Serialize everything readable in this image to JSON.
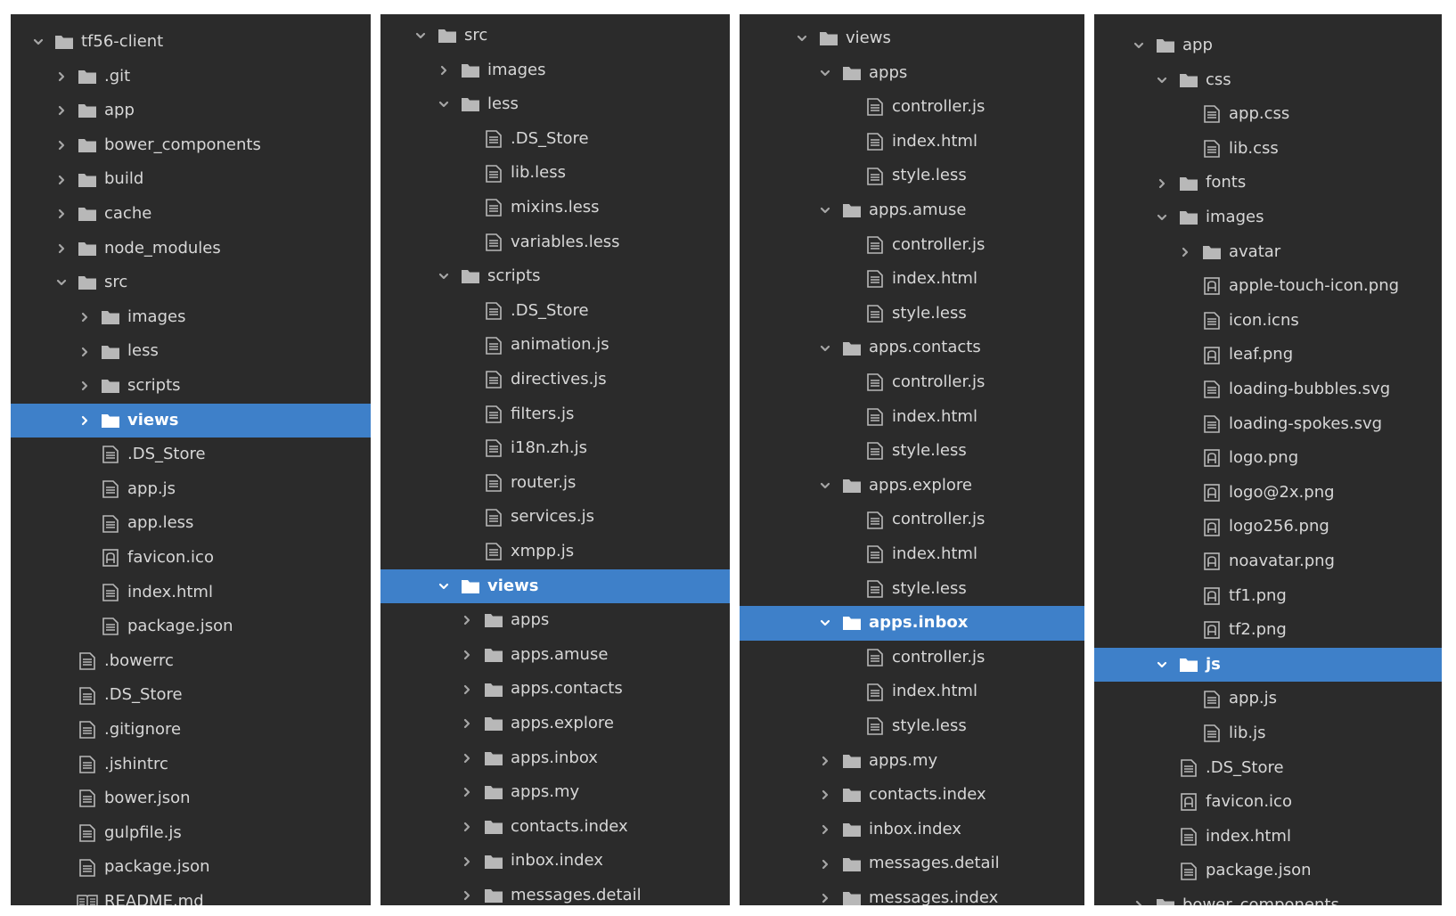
{
  "panels": [
    {
      "rows": [
        {
          "label": "tf56-client",
          "depth": 0,
          "chevron": "down",
          "icon": "folder-icon"
        },
        {
          "label": ".git",
          "depth": 1,
          "chevron": "right",
          "icon": "folder-icon"
        },
        {
          "label": "app",
          "depth": 1,
          "chevron": "right",
          "icon": "folder-icon"
        },
        {
          "label": "bower_components",
          "depth": 1,
          "chevron": "right",
          "icon": "folder-icon"
        },
        {
          "label": "build",
          "depth": 1,
          "chevron": "right",
          "icon": "folder-icon"
        },
        {
          "label": "cache",
          "depth": 1,
          "chevron": "right",
          "icon": "folder-icon"
        },
        {
          "label": "node_modules",
          "depth": 1,
          "chevron": "right",
          "icon": "folder-icon"
        },
        {
          "label": "src",
          "depth": 1,
          "chevron": "down",
          "icon": "folder-icon"
        },
        {
          "label": "images",
          "depth": 2,
          "chevron": "right",
          "icon": "folder-icon"
        },
        {
          "label": "less",
          "depth": 2,
          "chevron": "right",
          "icon": "folder-icon"
        },
        {
          "label": "scripts",
          "depth": 2,
          "chevron": "right",
          "icon": "folder-icon"
        },
        {
          "label": "views",
          "depth": 2,
          "chevron": "right",
          "icon": "folder-icon",
          "selected": true
        },
        {
          "label": ".DS_Store",
          "depth": 2,
          "icon": "file-icon"
        },
        {
          "label": "app.js",
          "depth": 2,
          "icon": "file-icon"
        },
        {
          "label": "app.less",
          "depth": 2,
          "icon": "file-icon"
        },
        {
          "label": "favicon.ico",
          "depth": 2,
          "icon": "image-file-icon"
        },
        {
          "label": "index.html",
          "depth": 2,
          "icon": "file-icon"
        },
        {
          "label": "package.json",
          "depth": 2,
          "icon": "file-icon"
        },
        {
          "label": ".bowerrc",
          "depth": 1,
          "icon": "file-icon"
        },
        {
          "label": ".DS_Store",
          "depth": 1,
          "icon": "file-icon"
        },
        {
          "label": ".gitignore",
          "depth": 1,
          "icon": "file-icon"
        },
        {
          "label": ".jshintrc",
          "depth": 1,
          "icon": "file-icon"
        },
        {
          "label": "bower.json",
          "depth": 1,
          "icon": "file-icon"
        },
        {
          "label": "gulpfile.js",
          "depth": 1,
          "icon": "file-icon"
        },
        {
          "label": "package.json",
          "depth": 1,
          "icon": "file-icon"
        },
        {
          "label": "README.md",
          "depth": 1,
          "icon": "book-icon"
        }
      ]
    },
    {
      "rows": [
        {
          "label": "src",
          "depth": 0,
          "chevron": "down",
          "icon": "folder-icon"
        },
        {
          "label": "images",
          "depth": 1,
          "chevron": "right",
          "icon": "folder-icon"
        },
        {
          "label": "less",
          "depth": 1,
          "chevron": "down",
          "icon": "folder-icon"
        },
        {
          "label": ".DS_Store",
          "depth": 2,
          "icon": "file-icon"
        },
        {
          "label": "lib.less",
          "depth": 2,
          "icon": "file-icon"
        },
        {
          "label": "mixins.less",
          "depth": 2,
          "icon": "file-icon"
        },
        {
          "label": "variables.less",
          "depth": 2,
          "icon": "file-icon"
        },
        {
          "label": "scripts",
          "depth": 1,
          "chevron": "down",
          "icon": "folder-icon"
        },
        {
          "label": ".DS_Store",
          "depth": 2,
          "icon": "file-icon"
        },
        {
          "label": "animation.js",
          "depth": 2,
          "icon": "file-icon"
        },
        {
          "label": "directives.js",
          "depth": 2,
          "icon": "file-icon"
        },
        {
          "label": "filters.js",
          "depth": 2,
          "icon": "file-icon"
        },
        {
          "label": "i18n.zh.js",
          "depth": 2,
          "icon": "file-icon"
        },
        {
          "label": "router.js",
          "depth": 2,
          "icon": "file-icon"
        },
        {
          "label": "services.js",
          "depth": 2,
          "icon": "file-icon"
        },
        {
          "label": "xmpp.js",
          "depth": 2,
          "icon": "file-icon"
        },
        {
          "label": "views",
          "depth": 1,
          "chevron": "down",
          "icon": "folder-icon",
          "selected": true
        },
        {
          "label": "apps",
          "depth": 2,
          "chevron": "right",
          "icon": "folder-icon"
        },
        {
          "label": "apps.amuse",
          "depth": 2,
          "chevron": "right",
          "icon": "folder-icon"
        },
        {
          "label": "apps.contacts",
          "depth": 2,
          "chevron": "right",
          "icon": "folder-icon"
        },
        {
          "label": "apps.explore",
          "depth": 2,
          "chevron": "right",
          "icon": "folder-icon"
        },
        {
          "label": "apps.inbox",
          "depth": 2,
          "chevron": "right",
          "icon": "folder-icon"
        },
        {
          "label": "apps.my",
          "depth": 2,
          "chevron": "right",
          "icon": "folder-icon"
        },
        {
          "label": "contacts.index",
          "depth": 2,
          "chevron": "right",
          "icon": "folder-icon"
        },
        {
          "label": "inbox.index",
          "depth": 2,
          "chevron": "right",
          "icon": "folder-icon"
        },
        {
          "label": "messages.detail",
          "depth": 2,
          "chevron": "right",
          "icon": "folder-icon"
        }
      ]
    },
    {
      "rows": [
        {
          "label": "views",
          "depth": 0,
          "chevron": "down",
          "icon": "folder-icon"
        },
        {
          "label": "apps",
          "depth": 1,
          "chevron": "down",
          "icon": "folder-icon"
        },
        {
          "label": "controller.js",
          "depth": 2,
          "icon": "file-icon"
        },
        {
          "label": "index.html",
          "depth": 2,
          "icon": "file-icon"
        },
        {
          "label": "style.less",
          "depth": 2,
          "icon": "file-icon"
        },
        {
          "label": "apps.amuse",
          "depth": 1,
          "chevron": "down",
          "icon": "folder-icon"
        },
        {
          "label": "controller.js",
          "depth": 2,
          "icon": "file-icon"
        },
        {
          "label": "index.html",
          "depth": 2,
          "icon": "file-icon"
        },
        {
          "label": "style.less",
          "depth": 2,
          "icon": "file-icon"
        },
        {
          "label": "apps.contacts",
          "depth": 1,
          "chevron": "down",
          "icon": "folder-icon"
        },
        {
          "label": "controller.js",
          "depth": 2,
          "icon": "file-icon"
        },
        {
          "label": "index.html",
          "depth": 2,
          "icon": "file-icon"
        },
        {
          "label": "style.less",
          "depth": 2,
          "icon": "file-icon"
        },
        {
          "label": "apps.explore",
          "depth": 1,
          "chevron": "down",
          "icon": "folder-icon"
        },
        {
          "label": "controller.js",
          "depth": 2,
          "icon": "file-icon"
        },
        {
          "label": "index.html",
          "depth": 2,
          "icon": "file-icon"
        },
        {
          "label": "style.less",
          "depth": 2,
          "icon": "file-icon"
        },
        {
          "label": "apps.inbox",
          "depth": 1,
          "chevron": "down",
          "icon": "folder-icon",
          "selected": true
        },
        {
          "label": "controller.js",
          "depth": 2,
          "icon": "file-icon"
        },
        {
          "label": "index.html",
          "depth": 2,
          "icon": "file-icon"
        },
        {
          "label": "style.less",
          "depth": 2,
          "icon": "file-icon"
        },
        {
          "label": "apps.my",
          "depth": 1,
          "chevron": "right",
          "icon": "folder-icon"
        },
        {
          "label": "contacts.index",
          "depth": 1,
          "chevron": "right",
          "icon": "folder-icon"
        },
        {
          "label": "inbox.index",
          "depth": 1,
          "chevron": "right",
          "icon": "folder-icon"
        },
        {
          "label": "messages.detail",
          "depth": 1,
          "chevron": "right",
          "icon": "folder-icon"
        },
        {
          "label": "messages.index",
          "depth": 1,
          "chevron": "right",
          "icon": "folder-icon"
        }
      ]
    },
    {
      "rows": [
        {
          "label": "app",
          "depth": 0,
          "chevron": "down",
          "icon": "folder-icon"
        },
        {
          "label": "css",
          "depth": 1,
          "chevron": "down",
          "icon": "folder-icon"
        },
        {
          "label": "app.css",
          "depth": 2,
          "icon": "file-icon"
        },
        {
          "label": "lib.css",
          "depth": 2,
          "icon": "file-icon"
        },
        {
          "label": "fonts",
          "depth": 1,
          "chevron": "right",
          "icon": "folder-icon"
        },
        {
          "label": "images",
          "depth": 1,
          "chevron": "down",
          "icon": "folder-icon"
        },
        {
          "label": "avatar",
          "depth": 2,
          "chevron": "right",
          "icon": "folder-icon"
        },
        {
          "label": "apple-touch-icon.png",
          "depth": 2,
          "icon": "image-file-icon"
        },
        {
          "label": "icon.icns",
          "depth": 2,
          "icon": "file-icon"
        },
        {
          "label": "leaf.png",
          "depth": 2,
          "icon": "image-file-icon"
        },
        {
          "label": "loading-bubbles.svg",
          "depth": 2,
          "icon": "file-icon"
        },
        {
          "label": "loading-spokes.svg",
          "depth": 2,
          "icon": "file-icon"
        },
        {
          "label": "logo.png",
          "depth": 2,
          "icon": "image-file-icon"
        },
        {
          "label": "logo@2x.png",
          "depth": 2,
          "icon": "image-file-icon"
        },
        {
          "label": "logo256.png",
          "depth": 2,
          "icon": "image-file-icon"
        },
        {
          "label": "noavatar.png",
          "depth": 2,
          "icon": "image-file-icon"
        },
        {
          "label": "tf1.png",
          "depth": 2,
          "icon": "image-file-icon"
        },
        {
          "label": "tf2.png",
          "depth": 2,
          "icon": "image-file-icon"
        },
        {
          "label": "js",
          "depth": 1,
          "chevron": "down",
          "icon": "folder-icon",
          "selected": true
        },
        {
          "label": "app.js",
          "depth": 2,
          "icon": "file-icon"
        },
        {
          "label": "lib.js",
          "depth": 2,
          "icon": "file-icon"
        },
        {
          "label": ".DS_Store",
          "depth": 1,
          "icon": "file-icon"
        },
        {
          "label": "favicon.ico",
          "depth": 1,
          "icon": "image-file-icon"
        },
        {
          "label": "index.html",
          "depth": 1,
          "icon": "file-icon"
        },
        {
          "label": "package.json",
          "depth": 1,
          "icon": "file-icon"
        },
        {
          "label": "bower_components",
          "depth": 0,
          "chevron": "right",
          "icon": "folder-icon"
        }
      ]
    }
  ]
}
